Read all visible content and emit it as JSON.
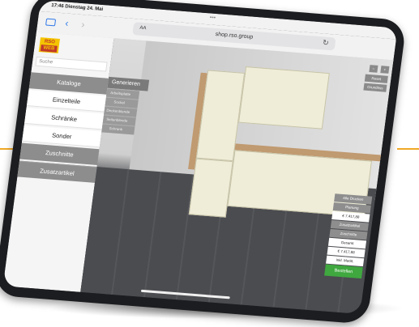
{
  "status": {
    "time": "17:46",
    "date": "Dienstag 24. Mai",
    "dots": "•••"
  },
  "browser": {
    "aa": "AA",
    "url": "shop.rso.group",
    "reload": "↻"
  },
  "logo": {
    "top": "RSO",
    "bottom": "WEB"
  },
  "sidebar": {
    "search_placeholder": "Suche",
    "items": [
      {
        "label": "Kataloge"
      },
      {
        "label": "Einzelteile"
      },
      {
        "label": "Schränke"
      },
      {
        "label": "Sonder"
      },
      {
        "label": "Zuschnitte"
      },
      {
        "label": "Zusatzartikel"
      }
    ]
  },
  "subpanel": {
    "header": "Generieren",
    "items": [
      {
        "label": "Arbeitsplatte"
      },
      {
        "label": "Sockel"
      },
      {
        "label": "Deckenblende"
      },
      {
        "label": "Seitenblende"
      },
      {
        "label": "Schrank"
      }
    ]
  },
  "viewport_controls": {
    "minus": "−",
    "plus": "+",
    "reset": "Reset",
    "view": "Grundriss"
  },
  "rightpanel": {
    "label1": "Alle Drucken",
    "label2": "Planung",
    "price1": "€ 7.417,88",
    "label3": "Zusatzartikel",
    "label4": "Zuschnitte",
    "total_label": "Gesamt",
    "total": "€ 7.417,88",
    "vat": "inkl. MwSt.",
    "order": "Bestellen"
  },
  "colors": {
    "accent": "#f0a826",
    "order_button": "#3fa83f",
    "browser_blue": "#2f78e8"
  }
}
